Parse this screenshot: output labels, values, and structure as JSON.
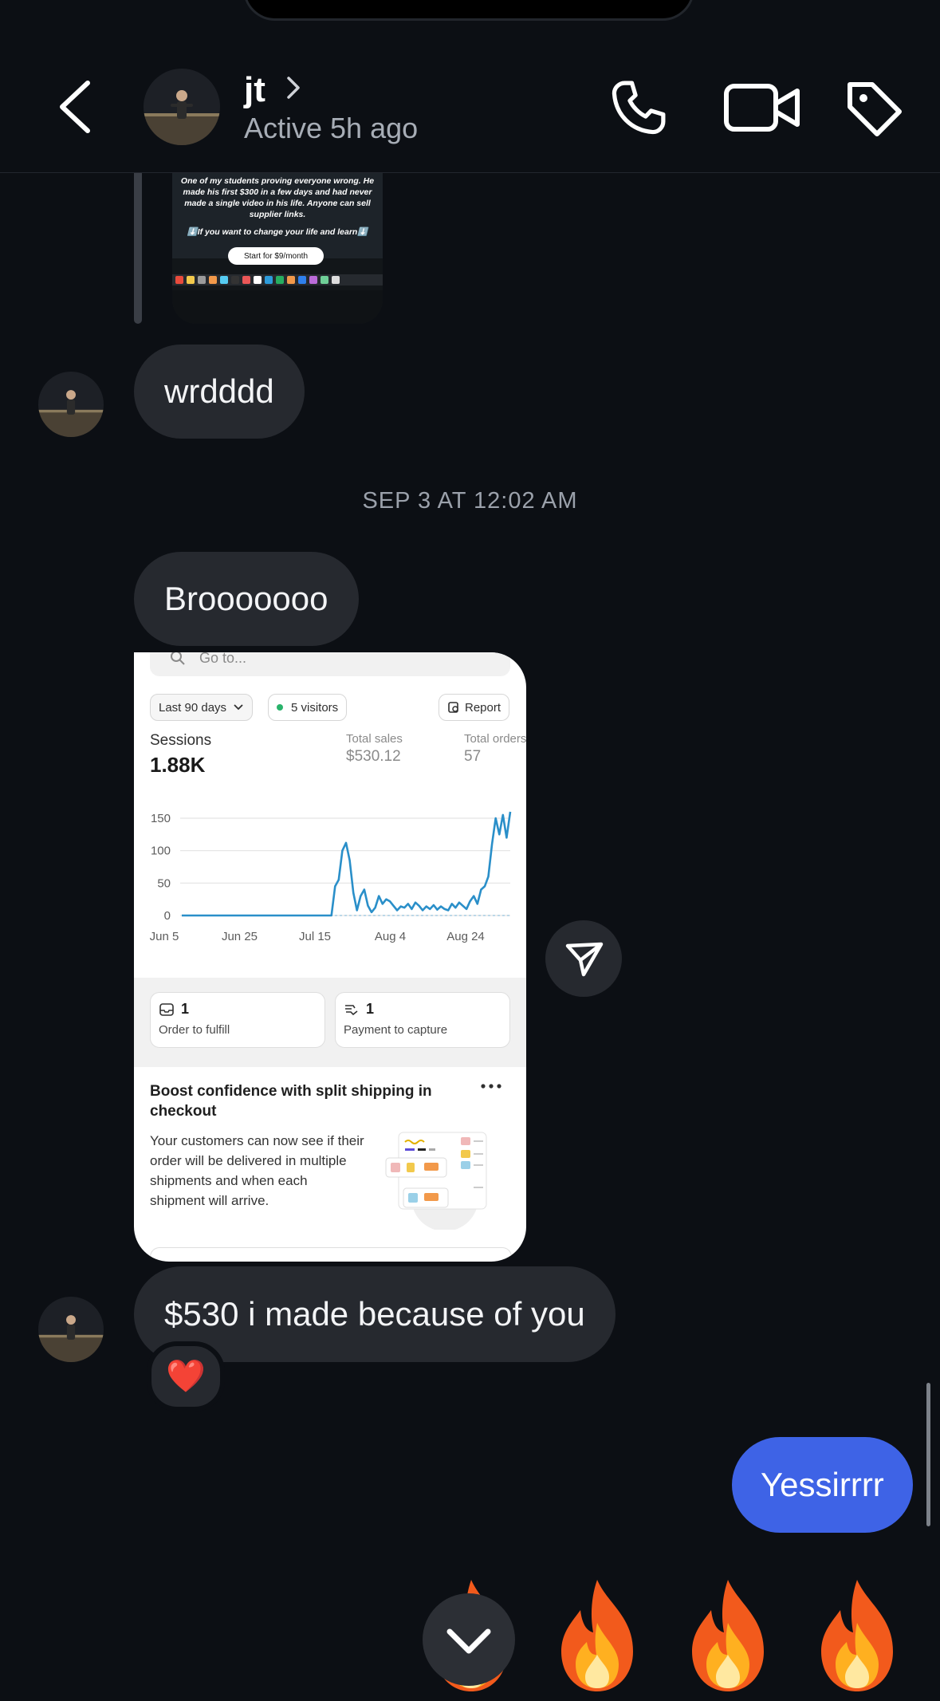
{
  "header": {
    "contact_name": "jt",
    "status": "Active 5h ago"
  },
  "shared_post": {
    "caption": "One of my students proving everyone wrong. He made his first $300 in a few days and had never made a single video in his life. Anyone can sell supplier links.",
    "caption2": "⬇️If you want to change your life and learn⬇️",
    "cta": "Start for $9/month"
  },
  "messages": [
    {
      "text": "wrdddd",
      "from": "contact"
    },
    {
      "text": "Brooooooo",
      "from": "contact"
    },
    {
      "text": "$530 i made because of you",
      "from": "contact",
      "reaction": "❤️"
    },
    {
      "text": "Yessirrrr",
      "from": "me"
    }
  ],
  "timestamp": "SEP 3 AT 12:02 AM",
  "screenshot": {
    "search_placeholder": "Go to...",
    "range": "Last 90 days",
    "visitors": "5 visitors",
    "report": "Report",
    "sessions_label": "Sessions",
    "sessions_value": "1.88K",
    "sales_label": "Total sales",
    "sales_value": "$530.12",
    "orders_label": "Total orders",
    "orders_value": "57",
    "card_fulfill_count": "1",
    "card_fulfill_label": "Order to fulfill",
    "card_capture_count": "1",
    "card_capture_label": "Payment to capture",
    "promo_title": "Boost confidence with split shipping in checkout",
    "promo_body": "Your customers can now see if their order will be delivered in multiple shipments and when each shipment will arrive."
  },
  "chart_data": {
    "type": "line",
    "title": "",
    "xlabel": "",
    "ylabel": "",
    "ylim": [
      0,
      150
    ],
    "yticks": [
      0,
      50,
      100,
      150
    ],
    "x_tick_labels": [
      "Jun 5",
      "Jun 25",
      "Jul 15",
      "Aug 4",
      "Aug 24"
    ],
    "series": [
      {
        "values": [
          0,
          0,
          0,
          0,
          0,
          0,
          0,
          0,
          0,
          0,
          0,
          0,
          0,
          0,
          0,
          0,
          0,
          0,
          0,
          0,
          0,
          0,
          0,
          0,
          0,
          0,
          0,
          0,
          0,
          0,
          0,
          0,
          0,
          0,
          0,
          0,
          0,
          0,
          0,
          0,
          0,
          0,
          0,
          0,
          0,
          0,
          0,
          0,
          0,
          0,
          0,
          0,
          0,
          0,
          0,
          0,
          0,
          0,
          0,
          0,
          0,
          0,
          0,
          0,
          0,
          0,
          0,
          0,
          0,
          0,
          0,
          0,
          0,
          0,
          0,
          0,
          0,
          0,
          0,
          0,
          0,
          0,
          0,
          0,
          0,
          0,
          0,
          0,
          0,
          0,
          0,
          0,
          0,
          0,
          0,
          0,
          0,
          0,
          0,
          0,
          0,
          0,
          0,
          0,
          0,
          0,
          0,
          0,
          0,
          0,
          0,
          0,
          0,
          0,
          0,
          0,
          0,
          0,
          0,
          0,
          0,
          0,
          0,
          0,
          0,
          0,
          0,
          0,
          0,
          0,
          0,
          0,
          0,
          0,
          0,
          0,
          0,
          0,
          0,
          0
        ]
      }
    ],
    "daily_sessions": [
      0,
      0,
      0,
      0,
      0,
      0,
      0,
      0,
      0,
      0,
      0,
      0,
      0,
      0,
      0,
      0,
      0,
      0,
      0,
      0,
      0,
      0,
      0,
      0,
      0,
      0,
      0,
      0,
      0,
      0,
      0,
      0,
      0,
      0,
      0,
      0,
      0,
      0,
      0,
      0,
      0,
      0,
      45,
      55,
      100,
      112,
      85,
      35,
      8,
      30,
      40,
      15,
      5,
      12,
      30,
      18,
      25,
      22,
      15,
      8,
      14,
      12,
      18,
      10,
      20,
      15,
      8,
      14,
      10,
      16,
      9,
      14,
      10,
      8,
      18,
      12,
      20,
      15,
      10,
      22,
      30,
      18,
      40,
      45,
      60,
      110,
      150,
      125,
      155,
      120,
      160
    ]
  },
  "colors": {
    "background": "#0c0f14",
    "bubble_received": "#26292f",
    "bubble_sent": "#3e63e6",
    "chart_line": "#2a8fc9"
  },
  "icons": [
    "back-chevron-icon",
    "phone-icon",
    "video-camera-icon",
    "tag-icon",
    "paper-plane-icon",
    "chevron-down-icon",
    "fire-emoji-icon",
    "heart-emoji-icon"
  ]
}
